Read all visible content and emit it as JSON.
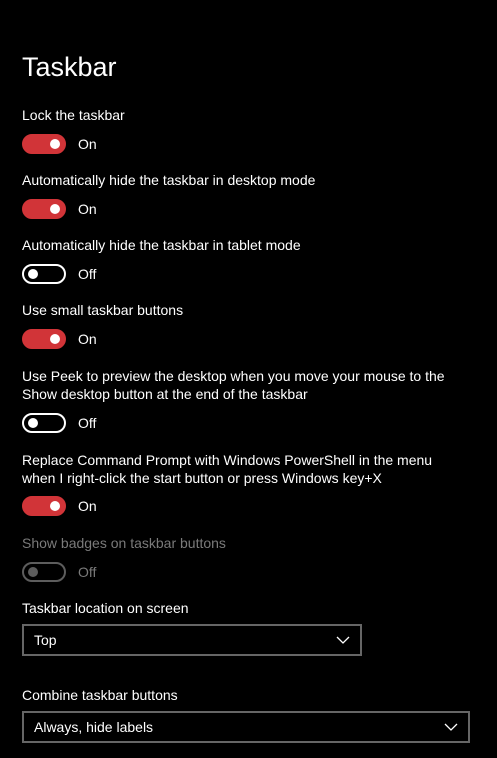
{
  "page": {
    "title": "Taskbar"
  },
  "settings": [
    {
      "label_lines": [
        "Lock the taskbar"
      ],
      "state": "On"
    },
    {
      "label_lines": [
        "Automatically hide the taskbar in desktop mode"
      ],
      "state": "On"
    },
    {
      "label_lines": [
        "Automatically hide the taskbar in tablet mode"
      ],
      "state": "Off"
    },
    {
      "label_lines": [
        "Use small taskbar buttons"
      ],
      "state": "On"
    },
    {
      "label_lines": [
        "Use Peek to preview the desktop when you move your mouse to the",
        "Show desktop button at the end of the taskbar"
      ],
      "state": "Off"
    },
    {
      "label_lines": [
        "Replace Command Prompt with Windows PowerShell in the menu",
        "when I right-click the start button or press Windows key+X"
      ],
      "state": "On"
    },
    {
      "label_lines": [
        "Show badges on taskbar buttons"
      ],
      "state": "Off",
      "disabled": true
    }
  ],
  "location": {
    "label": "Taskbar location on screen",
    "value": "Top"
  },
  "combine": {
    "label": "Combine taskbar buttons",
    "value": "Always, hide labels"
  },
  "colors": {
    "background": "#000000",
    "accent": "#d13438",
    "text": "#ffffff",
    "disabled_text": "#7a7a7a",
    "dropdown_border": "#666666"
  },
  "icons": {
    "dropdown": "chevron-down-icon"
  }
}
